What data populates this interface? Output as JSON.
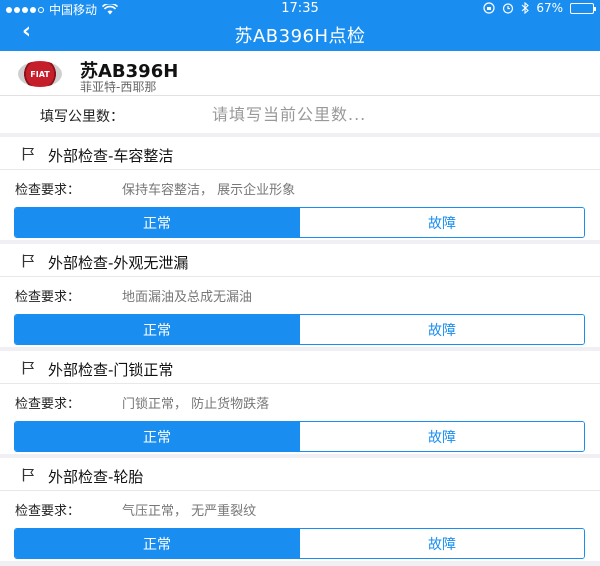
{
  "status_bar": {
    "carrier": "中国移动",
    "time": "17:35",
    "battery_percent": "67%",
    "battery_level": 0.67
  },
  "nav": {
    "back_icon": "‹",
    "title": "苏AB396H点检"
  },
  "vehicle": {
    "logo_text": "FIAT",
    "plate": "苏AB396H",
    "model": "菲亚特-西耶那"
  },
  "mileage": {
    "label": "填写公里数：",
    "placeholder": "请填写当前公里数..."
  },
  "checks": [
    {
      "name": "外部检查-车容整洁",
      "req_label": "检查要求：",
      "requirement": "保持车容整洁，  展示企业形象",
      "ok_label": "正常",
      "fault_label": "故障"
    },
    {
      "name": "外部检查-外观无泄漏",
      "req_label": "检查要求：",
      "requirement": "地面漏油及总成无漏油",
      "ok_label": "正常",
      "fault_label": "故障"
    },
    {
      "name": "外部检查-门锁正常",
      "req_label": "检查要求：",
      "requirement": "门锁正常，  防止货物跌落",
      "ok_label": "正常",
      "fault_label": "故障"
    },
    {
      "name": "外部检查-轮胎",
      "req_label": "检查要求：",
      "requirement": "气压正常，  无严重裂纹",
      "ok_label": "正常",
      "fault_label": "故障"
    }
  ],
  "colors": {
    "accent": "#1a8ef0"
  }
}
